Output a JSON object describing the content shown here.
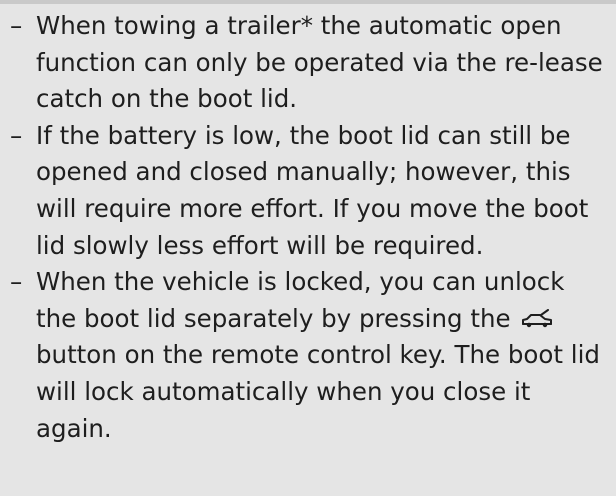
{
  "notes": {
    "bullet": "–",
    "items": [
      {
        "text": "When towing a trailer* the automatic open function can only be operated via the re-lease catch on the boot lid."
      },
      {
        "text": "If the battery is low, the boot lid can still be opened and closed manually; however, this will require more effort. If you move the boot lid slowly less effort will be required."
      },
      {
        "text_before_icon": "When the vehicle is locked, you can unlock the boot lid separately by pressing the",
        "icon": "boot-open-car-icon",
        "text_after_icon": "button on the remote control key. The boot lid will lock automatically when you close it again."
      }
    ]
  }
}
